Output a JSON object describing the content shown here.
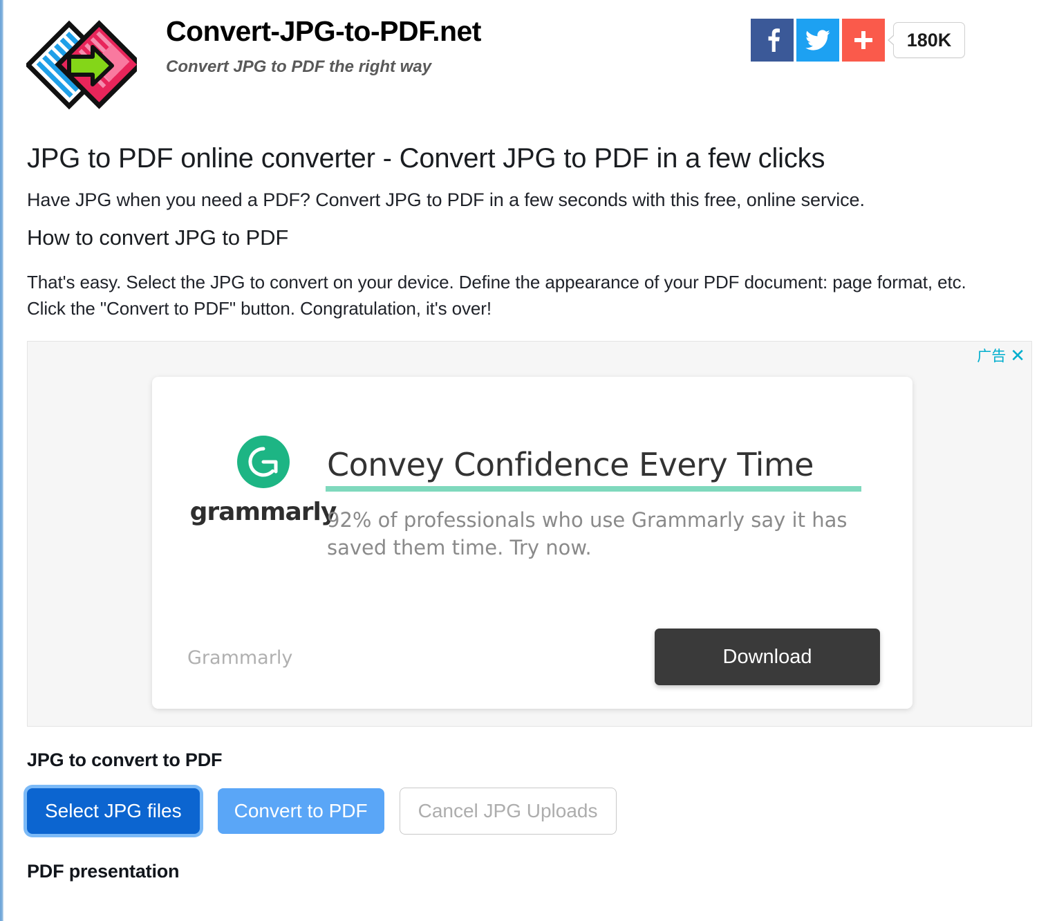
{
  "header": {
    "logo_icon": "jpg-to-pdf-convert-logo",
    "site_title": "Convert-JPG-to-PDF.net",
    "tagline": "Convert JPG to PDF the right way",
    "social": {
      "facebook_icon": "facebook-icon",
      "twitter_icon": "twitter-icon",
      "share_icon": "plus-share-icon",
      "share_count": "180K"
    }
  },
  "main": {
    "page_title": "JPG to PDF online converter - Convert JPG to PDF in a few clicks",
    "lede": "Have JPG when you need a PDF? Convert JPG to PDF in a few seconds with this free, online service.",
    "sub_title": "How to convert JPG to PDF",
    "howto": "That's easy. Select the JPG to convert on your device. Define the appearance of your PDF document: page format, etc. Click the \"Convert to PDF\" button. Congratulation, it's over!"
  },
  "ad": {
    "label": "广告",
    "close_icon": "close-x-icon",
    "brand_logo_icon": "grammarly-g-icon",
    "brand_wordmark": "grammarly",
    "headline": "Convey Confidence Every Time",
    "body": "92% of professionals who use Grammarly say it has saved them time. Try now.",
    "advertiser": "Grammarly",
    "cta_label": "Download",
    "accent_color": "#7fd9bd",
    "logo_color": "#1db584",
    "cta_color": "#3a3a3a",
    "label_color": "#00aecd"
  },
  "upload": {
    "section_label": "JPG to convert to PDF",
    "select_button": "Select JPG files",
    "convert_button": "Convert to PDF",
    "cancel_button": "Cancel JPG Uploads",
    "select_color": "#0c65d0",
    "convert_color": "#5aa6f7",
    "focus_ring_color": "#7cbaf7"
  },
  "footer": {
    "section_label": "PDF presentation"
  }
}
